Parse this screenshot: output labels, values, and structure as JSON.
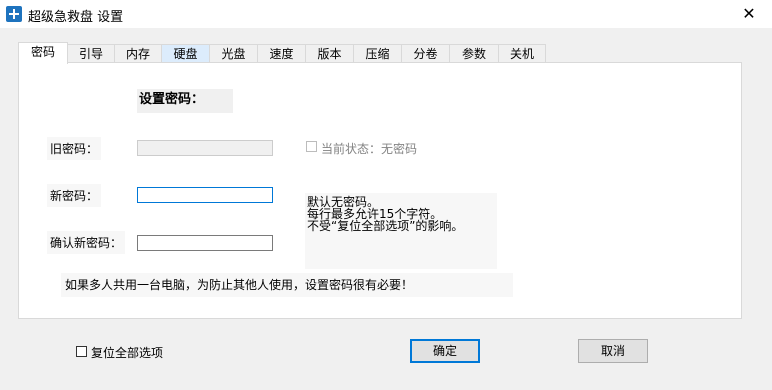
{
  "window": {
    "title": "超级急救盘 设置",
    "close_glyph": "✕"
  },
  "tabs": [
    "密码",
    "引导",
    "内存",
    "硬盘",
    "光盘",
    "速度",
    "版本",
    "压缩",
    "分卷",
    "参数",
    "关机"
  ],
  "active_tab_index": 0,
  "password_page": {
    "heading": "设置密码：",
    "old_password_label": "旧密码：",
    "new_password_label": "新密码：",
    "confirm_password_label": "确认新密码：",
    "old_password_value": "",
    "new_password_value": "",
    "confirm_password_value": "",
    "current_status_label": "当前状态：无密码",
    "info_lines": [
      "默认无密码。",
      "每行最多允许15个字符。",
      "不受“复位全部选项”的影响。"
    ],
    "note": "如果多人共用一台电脑，为防止其他人使用，设置密码很有必要！"
  },
  "footer": {
    "reset_all_label": "复位全部选项",
    "ok_label": "确定",
    "cancel_label": "取消"
  }
}
